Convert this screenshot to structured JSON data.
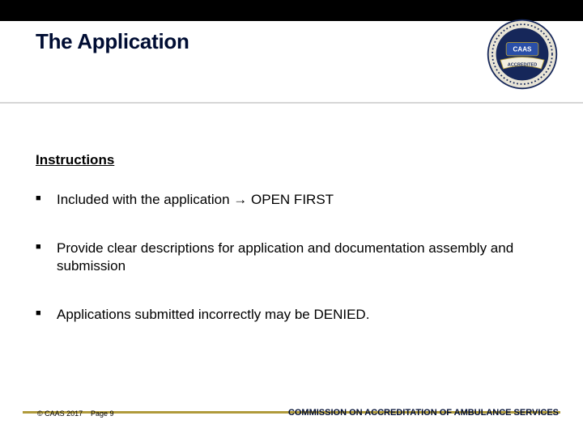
{
  "title": "The Application",
  "subtitle": "Instructions",
  "bullets": [
    "Included with the application →  OPEN FIRST",
    "Provide clear descriptions for application and documentation assembly and submission",
    "Applications submitted incorrectly may be DENIED."
  ],
  "footer": {
    "copyright": "© CAAS 2017",
    "page": "Page 9",
    "org": "COMMISSION ON ACCREDITATION OF AMBULANCE SERVICES"
  },
  "logo": {
    "top_label": "CAAS",
    "bottom_label": "ACCREDITED"
  },
  "colors": {
    "navy": "#16275a",
    "blue": "#2a4fa8",
    "gold": "#b09a3b",
    "grey": "#d6d6d6"
  }
}
